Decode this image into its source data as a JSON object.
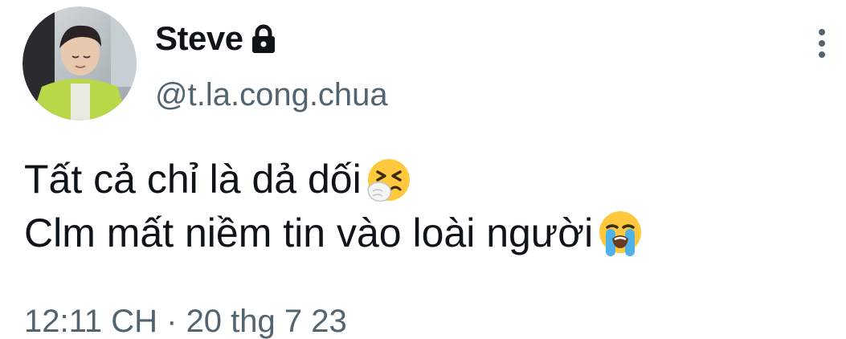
{
  "user": {
    "display_name": "Steve",
    "handle": "@t.la.cong.chua"
  },
  "icons": {
    "lock": "lock-icon",
    "more": "more-vertical-icon",
    "emoji_1": "sneezing-face-emoji",
    "emoji_2": "loudly-crying-face-emoji"
  },
  "tweet": {
    "line_1": "Tất cả chỉ là dả dối",
    "line_2": "Clm mất niềm tin vào loài người"
  },
  "timestamp": "12:11 CH · 20 thg 7 23",
  "colors": {
    "text": "#0f1419",
    "secondary": "#536471",
    "background": "#ffffff"
  }
}
